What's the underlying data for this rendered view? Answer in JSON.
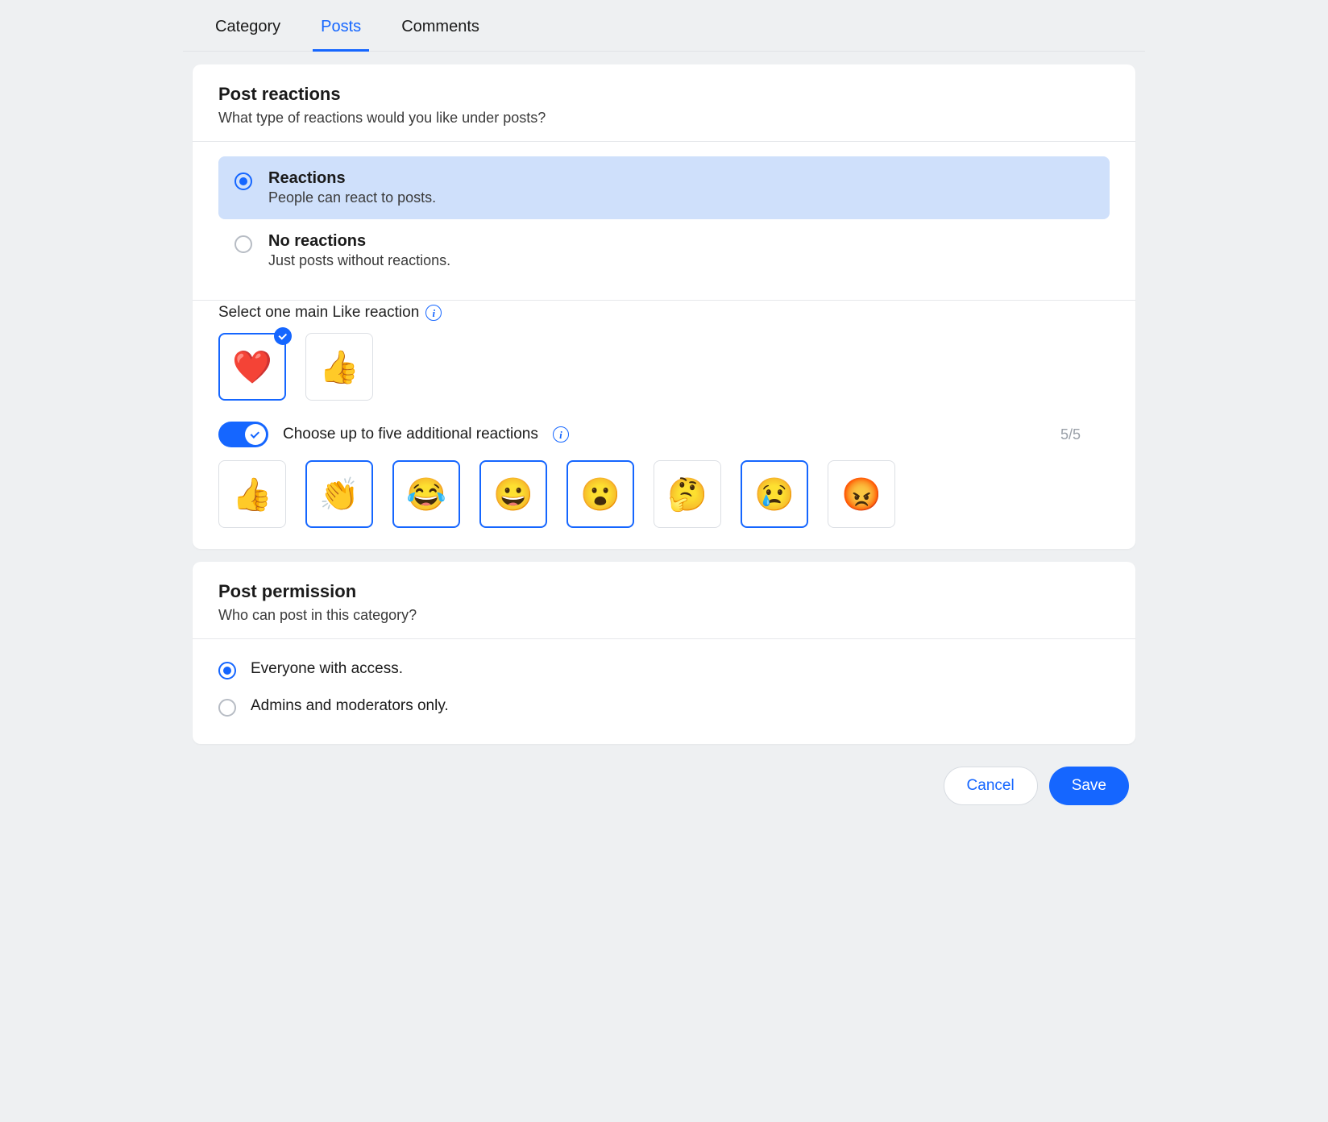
{
  "tabs": {
    "category": "Category",
    "posts": "Posts",
    "comments": "Comments",
    "active": "posts"
  },
  "reactions": {
    "title": "Post reactions",
    "subtitle": "What type of reactions would you like under posts?",
    "opt1_title": "Reactions",
    "opt1_sub": "People can react to posts.",
    "opt2_title": "No reactions",
    "opt2_sub": "Just posts without reactions.",
    "main_label": "Select one main Like reaction",
    "main": [
      {
        "emoji": "❤️",
        "name": "heart",
        "selected": true
      },
      {
        "emoji": "👍",
        "name": "thumbs-up",
        "selected": false
      }
    ],
    "additional_label": "Choose up to five additional reactions",
    "counter": "5/5",
    "additional": [
      {
        "emoji": "👍",
        "name": "thumbs-up",
        "selected": false
      },
      {
        "emoji": "👏",
        "name": "clap",
        "selected": true
      },
      {
        "emoji": "😂",
        "name": "tears-of-joy",
        "selected": true
      },
      {
        "emoji": "😀",
        "name": "smile",
        "selected": true
      },
      {
        "emoji": "😮",
        "name": "surprised",
        "selected": true
      },
      {
        "emoji": "🤔",
        "name": "thinking",
        "selected": false
      },
      {
        "emoji": "😢",
        "name": "sad",
        "selected": true
      },
      {
        "emoji": "😡",
        "name": "angry",
        "selected": false
      }
    ]
  },
  "permission": {
    "title": "Post permission",
    "subtitle": "Who can post in this category?",
    "opt1": "Everyone with access.",
    "opt2": "Admins and moderators only."
  },
  "footer": {
    "cancel": "Cancel",
    "save": "Save"
  }
}
